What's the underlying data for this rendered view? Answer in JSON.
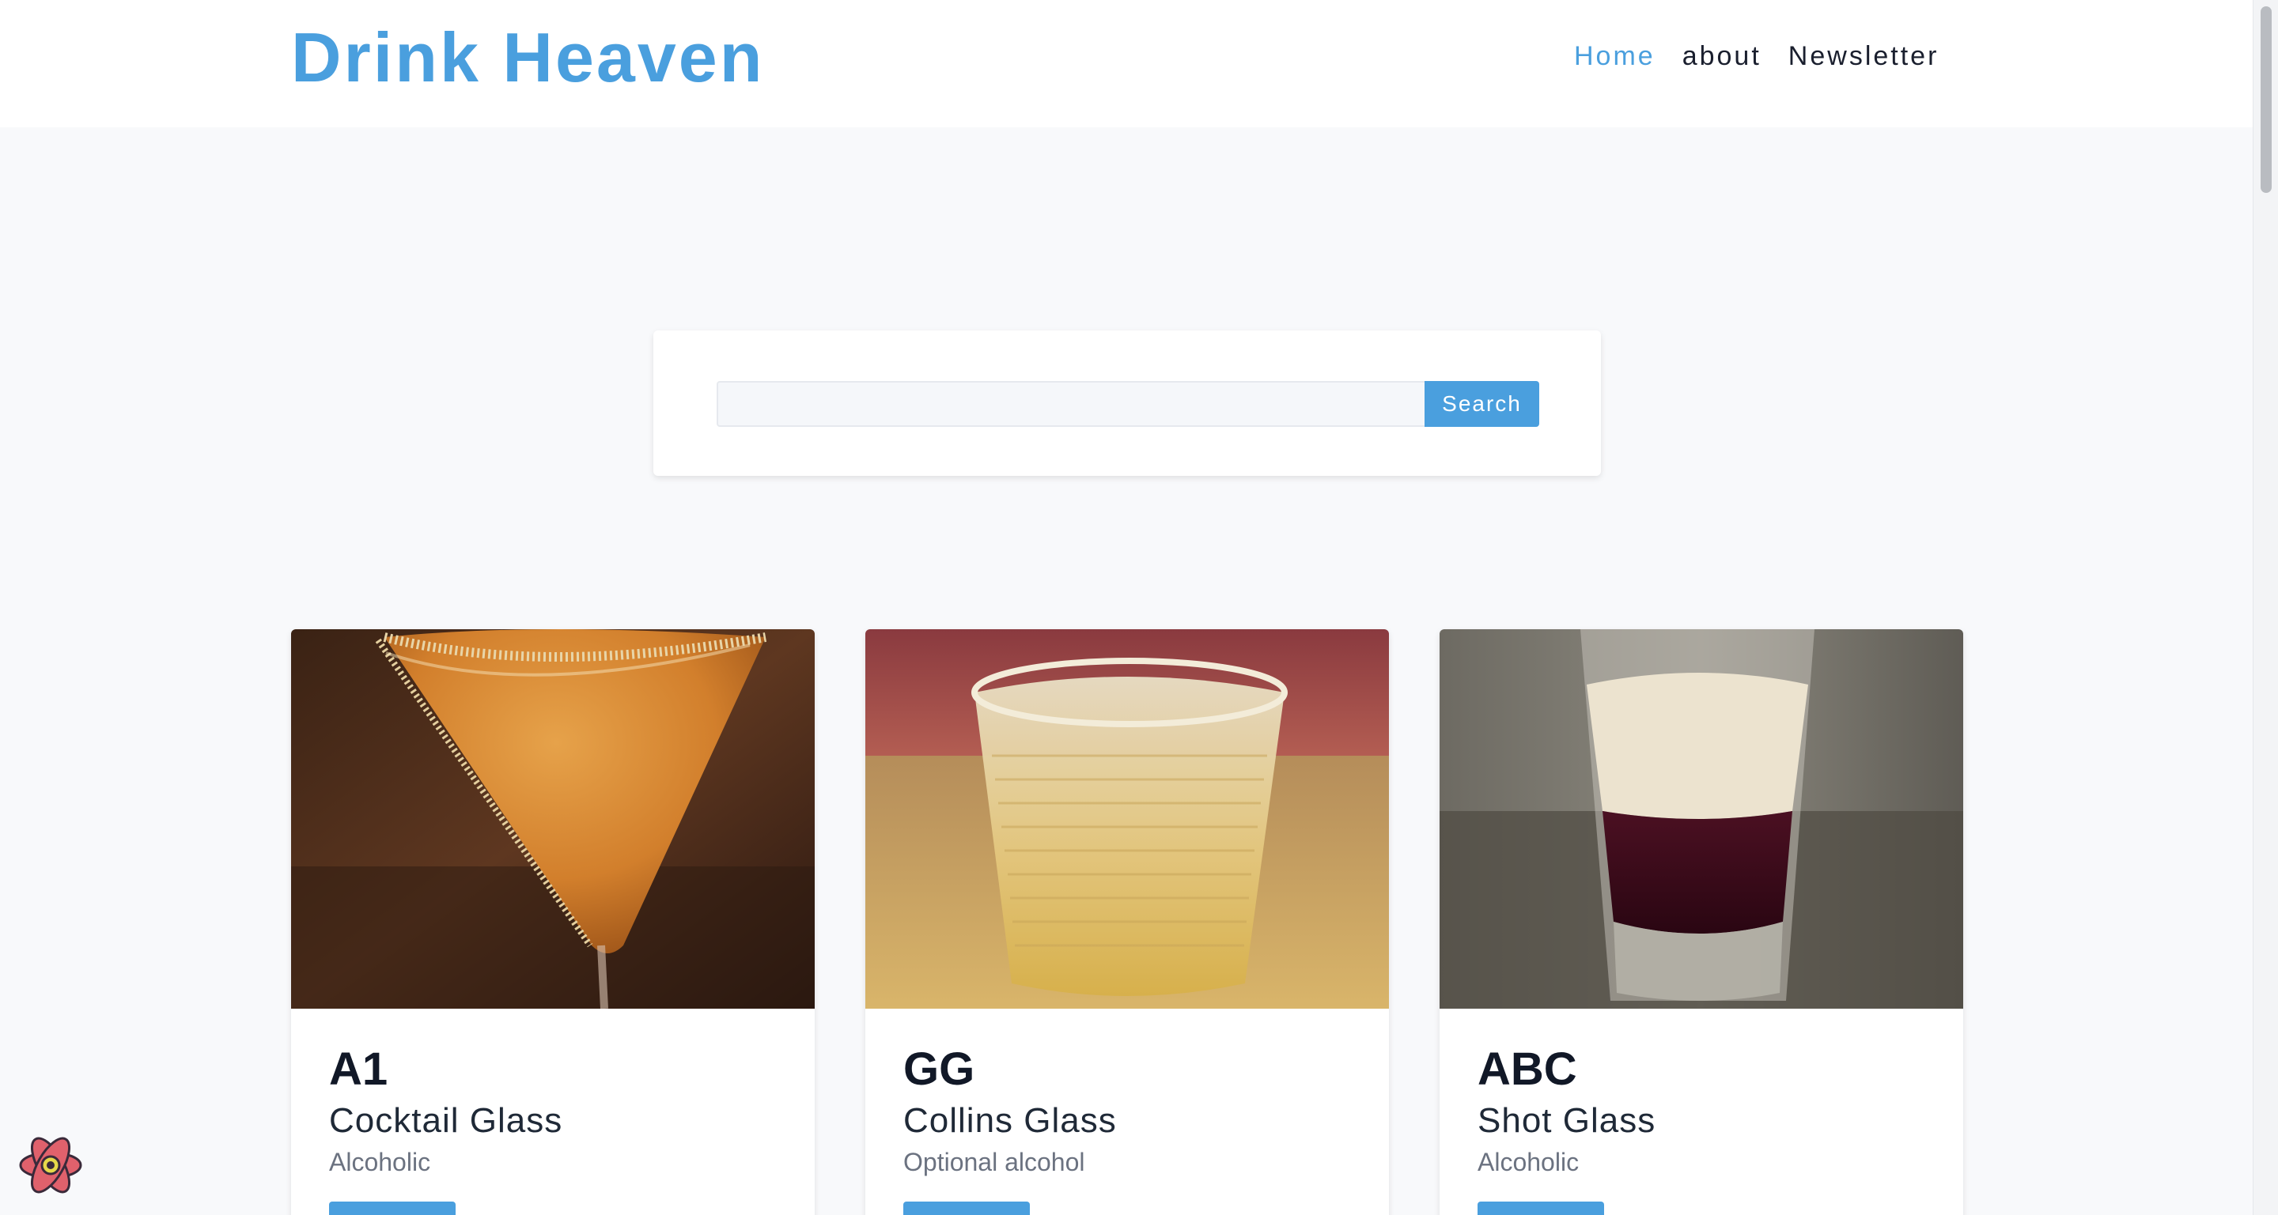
{
  "header": {
    "logo": "Drink Heaven",
    "nav": [
      {
        "label": "Home",
        "active": true
      },
      {
        "label": "about",
        "active": false
      },
      {
        "label": "Newsletter",
        "active": false
      }
    ]
  },
  "search": {
    "value": "",
    "placeholder": "",
    "button_label": "Search"
  },
  "cards": [
    {
      "name": "A1",
      "glass": "Cocktail Glass",
      "type": "Alcoholic",
      "image": "cocktail-glass-drink-photo"
    },
    {
      "name": "GG",
      "glass": "Collins Glass",
      "type": "Optional alcohol",
      "image": "collins-glass-drink-photo"
    },
    {
      "name": "ABC",
      "glass": "Shot Glass",
      "type": "Alcoholic",
      "image": "shot-glass-drink-photo"
    }
  ],
  "colors": {
    "brand": "#4a9fde",
    "page_background": "#f8f9fb",
    "text_dark": "#111827",
    "text_muted": "#6b7280"
  },
  "icons": {
    "devtools": "react-devtools-icon"
  }
}
